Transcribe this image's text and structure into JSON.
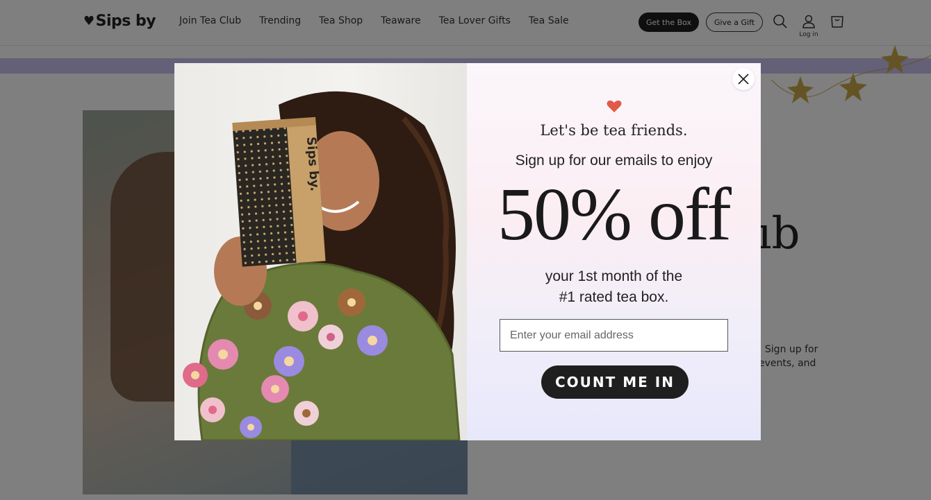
{
  "header": {
    "logo": "Sips by",
    "nav": [
      "Join Tea Club",
      "Trending",
      "Tea Shop",
      "Teaware",
      "Tea Lover Gifts",
      "Tea Sale"
    ],
    "get_box": "Get the Box",
    "give_gift": "Give a Gift",
    "login": "Log in"
  },
  "hero": {
    "title_fragment": "ıb",
    "text_fragment": ". Sign up for\nevents, and"
  },
  "modal": {
    "box_label": "Sips by.",
    "tagline": "Let's be tea friends.",
    "signup": "Sign up for our emails to enjoy",
    "offer": "50% off",
    "sub_line1": "your 1st month of the",
    "sub_line2": "#1 rated tea box.",
    "email_placeholder": "Enter your email address",
    "submit": "COUNT ME IN"
  },
  "colors": {
    "heart": "#e05a47",
    "promo_strip": "#c6c0ee",
    "button_dark": "#1f1f1f",
    "star": "#c9a84a"
  }
}
